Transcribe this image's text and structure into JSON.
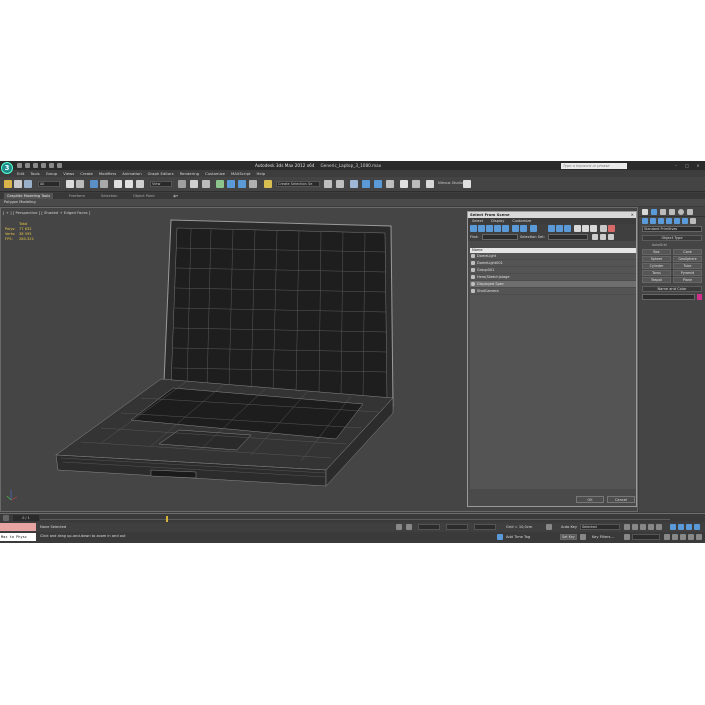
{
  "app": {
    "logo": "3",
    "title": "Autodesk 3ds Max 2012 x64",
    "file": "Generic_Laptop_3_1080.max",
    "search_placeholder": "Type a keyword or phrase"
  },
  "menu": [
    "Edit",
    "Tools",
    "Group",
    "Views",
    "Create",
    "Modifiers",
    "Animation",
    "Graph Editors",
    "Rendering",
    "Customize",
    "MAXScript",
    "Help"
  ],
  "toolbar": {
    "selection_filter": "All",
    "ref_coord": "View",
    "named_selection": "Create Selection Se",
    "render_label": "Nitrous Studio"
  },
  "ribbon": {
    "tabs": [
      "Graphite Modeling Tools",
      "Freeform",
      "Selection",
      "Object Paint"
    ],
    "active_tab": "Graphite Modeling Tools",
    "sub_label": "Polygon Modeling"
  },
  "viewport": {
    "label": "[ + ] [ Perspective ] [ Shaded + Edged Faces ]",
    "stats": [
      {
        "key": "",
        "value": "Total"
      },
      {
        "key": "Polys:",
        "value": "77 632"
      },
      {
        "key": "Verts:",
        "value": "38 595"
      },
      {
        "key": "",
        "value": ""
      },
      {
        "key": "FPS:",
        "value": "280.322"
      }
    ]
  },
  "dialog": {
    "title": "Select From Scene",
    "menus": [
      "Select",
      "Display",
      "Customize"
    ],
    "find_label": "Find:",
    "selection_set_label": "Selection Set:",
    "column_header": "Name",
    "items": [
      {
        "name": "DomeLight",
        "selected": false
      },
      {
        "name": "DomeLight001",
        "selected": false
      },
      {
        "name": "Group001",
        "selected": false
      },
      {
        "name": "Hero(Sketch)stage",
        "selected": false
      },
      {
        "name": "Displayed Spec",
        "selected": true
      },
      {
        "name": "ShotCamera",
        "selected": false
      }
    ],
    "ok": "OK",
    "cancel": "Cancel"
  },
  "command_panel": {
    "category": "Standard Primitives",
    "object_type": "Object Type",
    "autogrid": "AutoGrid",
    "buttons": [
      "Box",
      "Cone",
      "Sphere",
      "GeoSphere",
      "Cylinder",
      "Tube",
      "Torus",
      "Pyramid",
      "Teapot",
      "Plane"
    ],
    "name_and_color": "Name and Color",
    "color": "#d0308a"
  },
  "timeline": {
    "frame": "0 / 1"
  },
  "status": {
    "maxscript_label": "Max to Physc",
    "selection": "None Selected",
    "prompt": "Click and drag up-and-down to zoom in and out",
    "grid": "Grid = 10,0cm",
    "add_time_tag": "Add Time Tag",
    "auto_key": "Auto Key",
    "set_key": "Set Key",
    "key_filters": "Key Filters...",
    "key_mode": "Selected"
  }
}
